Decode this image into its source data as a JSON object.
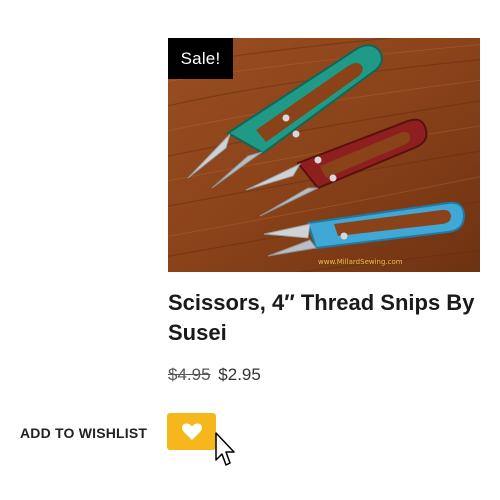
{
  "product": {
    "badge": "Sale!",
    "title": "Scissors, 4″ Thread Snips By Susei",
    "price_old": "$4.95",
    "price_new": "$2.95",
    "image_watermark": "www.MillardSewing.com",
    "image_subject": "three thread snips (teal, red, blue) on wood background"
  },
  "wishlist": {
    "label": "ADD TO WISHLIST",
    "button_icon": "heart-icon",
    "button_color": "#f5b71c"
  },
  "colors": {
    "snip_teal": "#1f9a86",
    "snip_red": "#8e1f1f",
    "snip_blue": "#3fa8d6"
  }
}
